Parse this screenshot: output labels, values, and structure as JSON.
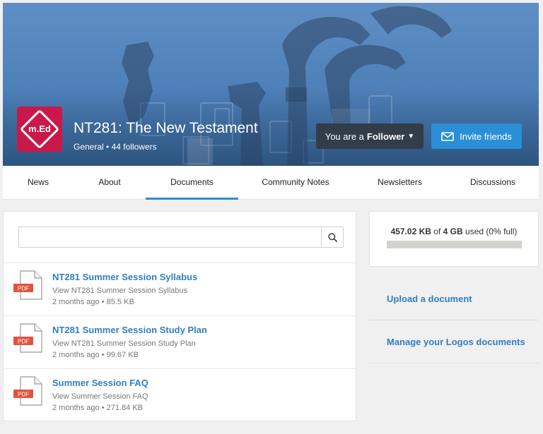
{
  "group": {
    "logo_text": "m.Ed",
    "title": "NT281: The New Testament",
    "category": "General",
    "followers": "44 followers"
  },
  "header": {
    "follower_prefix": "You are a",
    "follower_bold": "Follower",
    "invite_label": "Invite friends"
  },
  "tabs": [
    {
      "label": "News"
    },
    {
      "label": "About"
    },
    {
      "label": "Documents",
      "active": true
    },
    {
      "label": "Community Notes"
    },
    {
      "label": "Newsletters"
    },
    {
      "label": "Discussions"
    }
  ],
  "search": {
    "value": "",
    "placeholder": ""
  },
  "documents": [
    {
      "type": "PDF",
      "title": "NT281 Summer Session Syllabus",
      "action": "View NT281 Summer Session Syllabus",
      "age": "2 months ago",
      "size": "85.5 KB"
    },
    {
      "type": "PDF",
      "title": "NT281 Summer Session Study Plan",
      "action": "View NT281 Summer Session Study Plan",
      "age": "2 months ago",
      "size": "99.67 KB"
    },
    {
      "type": "PDF",
      "title": "Summer Session FAQ",
      "action": "View Summer Session FAQ",
      "age": "2 months ago",
      "size": "271.84 KB"
    }
  ],
  "storage": {
    "used": "457.02 KB",
    "of_word": "of",
    "total": "4 GB",
    "used_word": "used",
    "percent_label": "(0% full)",
    "fill_fraction": 0
  },
  "side_links": {
    "upload": "Upload a document",
    "manage": "Manage your Logos documents"
  },
  "colors": {
    "accent": "#2f7fc1",
    "invite_button": "#2a8fd6",
    "follower_button": "#333d48",
    "logo_bg": "#c8194a",
    "pdf_badge": "#e2533f"
  },
  "icons": {
    "search": "search-icon",
    "invite": "envelope-icon",
    "caret": "caret-down-icon",
    "file": "pdf-file-icon"
  }
}
